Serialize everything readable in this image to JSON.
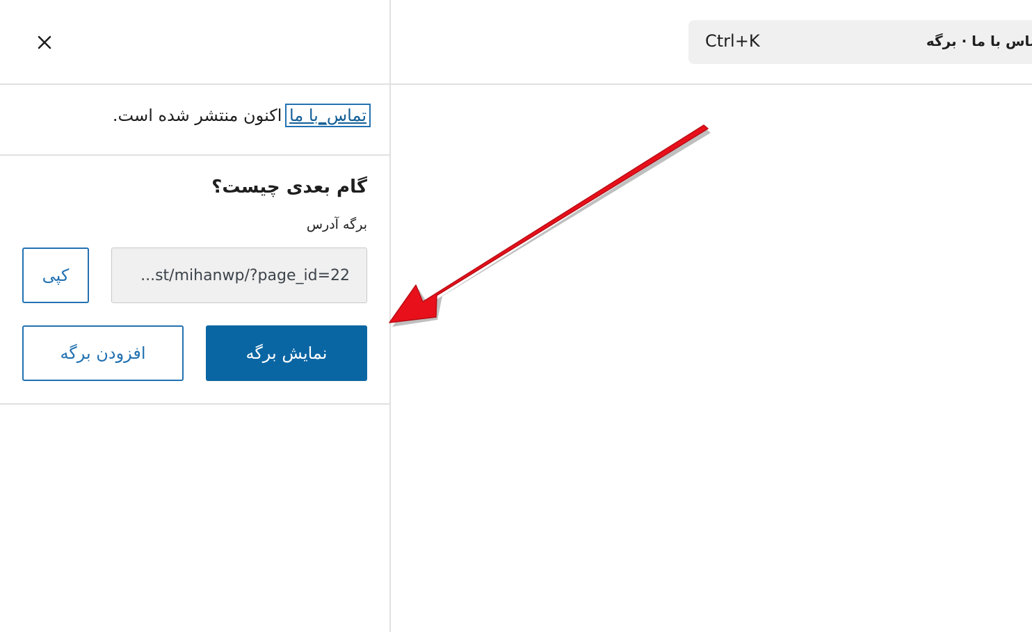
{
  "header": {
    "document_title": "تماس با ما · برگه",
    "shortcut": "Ctrl+K"
  },
  "publish_panel": {
    "page_link": "تماس_با ما",
    "published_suffix": "اکنون منتشر شده است.",
    "next_step_title": "گام بعدی چیست؟",
    "address_label": "برگه آدرس",
    "url_value": "...st/mihanwp/?page_id=22",
    "copy_label": "کپی",
    "view_page_label": "نمایش برگه",
    "add_page_label": "افزودن برگه"
  },
  "annotation": {
    "arrow_color": "#e8101b",
    "points_to": "view-page-button"
  },
  "icons": {
    "close": "close-icon"
  },
  "colors": {
    "primary": "#0a66a3",
    "link": "#135e96",
    "border": "#e0e0e0",
    "field_bg": "#f0f0f0"
  }
}
